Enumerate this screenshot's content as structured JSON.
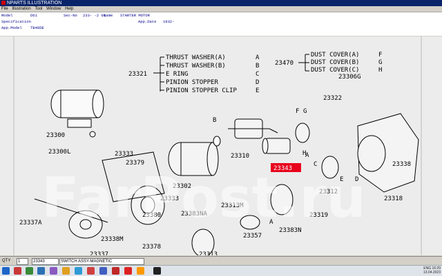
{
  "window": {
    "title": "NPARTS ILLUSTRATION"
  },
  "menu": [
    "File",
    "Illustration",
    "Tool",
    "Window",
    "Help"
  ],
  "info": {
    "model_label": "Model",
    "model_value": "D61",
    "secno_label": "Sec-No",
    "secno_value": "233-  -2 01",
    "name_label": "Name",
    "name_value": "STARTER MOTOR",
    "spec_label": "Specification",
    "appdate_label": "App.Date",
    "appdate_value": "1932-",
    "appmodel_label": "App.Model",
    "appmodel_value": "TB48DE"
  },
  "legend_left": {
    "code": "23321",
    "items": [
      {
        "text": "THRUST WASHER(A)",
        "key": "A"
      },
      {
        "text": "THRUST WASHER(B)",
        "key": "B"
      },
      {
        "text": "E RING",
        "key": "C"
      },
      {
        "text": "PINION STOPPER",
        "key": "D"
      },
      {
        "text": "PINION STOPPER CLIP",
        "key": "E"
      }
    ]
  },
  "legend_right": {
    "code": "23470",
    "items": [
      {
        "text": "DUST COVER(A)",
        "key": "F"
      },
      {
        "text": "DUST COVER(B)",
        "key": "G"
      },
      {
        "text": "DUST COVER(C)",
        "key": "H"
      }
    ]
  },
  "part_labels": [
    "23300",
    "23300L",
    "23333",
    "23379",
    "23333",
    "23337A",
    "23338M",
    "23337",
    "23380",
    "23378",
    "23302",
    "23310",
    "23313M",
    "23383NA",
    "23357",
    "23313",
    "23383N",
    "23319",
    "23312",
    "23338",
    "23318",
    "23322",
    "23306G",
    "23306G"
  ],
  "letter_labels": [
    "B",
    "F",
    "G",
    "H",
    "C",
    "D",
    "E",
    "A",
    "A",
    "D",
    "E"
  ],
  "highlight": {
    "code": "23343"
  },
  "watermark": "FarPost.ru",
  "status": {
    "qty_label": "QTY",
    "qty_value": "1",
    "part_no": "23343",
    "part_name": "SWITCH ASSY-MAGNETIC"
  },
  "tray": {
    "lang": "ENG",
    "time": "16:29",
    "date": "13.04.2023"
  },
  "colors": {
    "highlight": "#e8001c",
    "titlebar": "#0a246a"
  }
}
